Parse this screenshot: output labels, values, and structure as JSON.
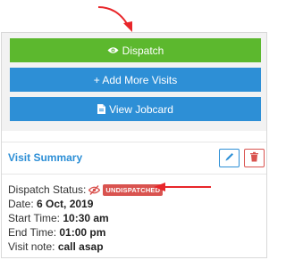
{
  "buttons": {
    "dispatch": "Dispatch",
    "add_visits": "+ Add More Visits",
    "view_jobcard": "View Jobcard"
  },
  "summary": {
    "title": "Visit Summary",
    "dispatch_label": "Dispatch Status:",
    "dispatch_badge": "UNDISPATCHED",
    "date_label": "Date:",
    "date_value": "6 Oct, 2019",
    "start_label": "Start Time:",
    "start_value": "10:30 am",
    "end_label": "End Time:",
    "end_value": "01:00 pm",
    "note_label": "Visit note:",
    "note_value": "call asap"
  },
  "icons": {
    "dispatch": "eye-icon",
    "jobcard": "document-icon",
    "edit": "pencil-icon",
    "delete": "trash-icon",
    "status": "eye-slash-icon"
  },
  "colors": {
    "green": "#5cb82e",
    "blue": "#2d8fd6",
    "red": "#d9534f",
    "annotation": "#e8262a"
  }
}
